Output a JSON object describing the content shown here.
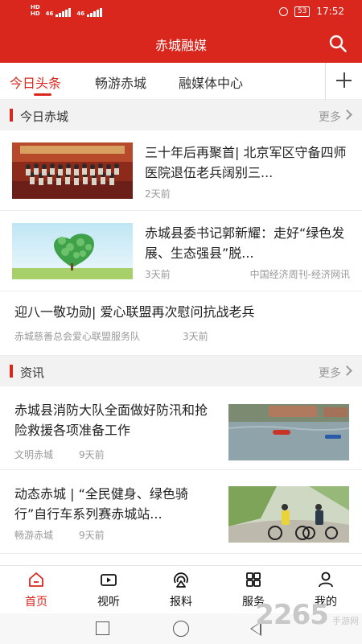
{
  "status_bar": {
    "signal_1": "46",
    "signal_2": "46",
    "hd_1": "HD",
    "hd_2": "HD",
    "battery": "53",
    "time": "17:52"
  },
  "app": {
    "title": "赤城融媒"
  },
  "tabs": [
    {
      "label": "今日头条",
      "active": true
    },
    {
      "label": "畅游赤城",
      "active": false
    },
    {
      "label": "融媒体中心",
      "active": false
    }
  ],
  "sections": {
    "today": {
      "title": "今日赤城",
      "more": "更多"
    },
    "news": {
      "title": "资讯",
      "more": "更多"
    }
  },
  "today_items": [
    {
      "headline": "三十年后再聚首| 北京军区守备四师医院退伍老兵阔别三...",
      "time": "2天前",
      "source": ""
    },
    {
      "headline": "赤城县委书记郭新耀：走好“绿色发展、生态强县”脱...",
      "time": "3天前",
      "source": "中国经济周刊-经济网讯"
    },
    {
      "headline": "迎八一敬功勋| 爱心联盟再次慰问抗战老兵",
      "source": "赤城慈善总会爱心联盟服务队",
      "time": "3天前"
    }
  ],
  "news_items": [
    {
      "headline": "赤城县消防大队全面做好防汛和抢险救援各项准备工作",
      "source": "文明赤城",
      "time": "9天前"
    },
    {
      "headline": "动态赤城 | “全民健身、绿色骑行”自行车系列赛赤城站...",
      "source": "畅游赤城",
      "time": "9天前"
    }
  ],
  "bottom_nav": [
    {
      "label": "首页",
      "icon": "home-icon",
      "active": true
    },
    {
      "label": "视听",
      "icon": "video-icon",
      "active": false
    },
    {
      "label": "报料",
      "icon": "broadcast-icon",
      "active": false
    },
    {
      "label": "服务",
      "icon": "grid-icon",
      "active": false
    },
    {
      "label": "我的",
      "icon": "user-icon",
      "active": false
    }
  ],
  "watermark": {
    "number": "2265",
    "sub": "手游网"
  },
  "colors": {
    "brand": "#d9271d",
    "muted": "#999999",
    "section_bg": "#f2f2f2"
  }
}
